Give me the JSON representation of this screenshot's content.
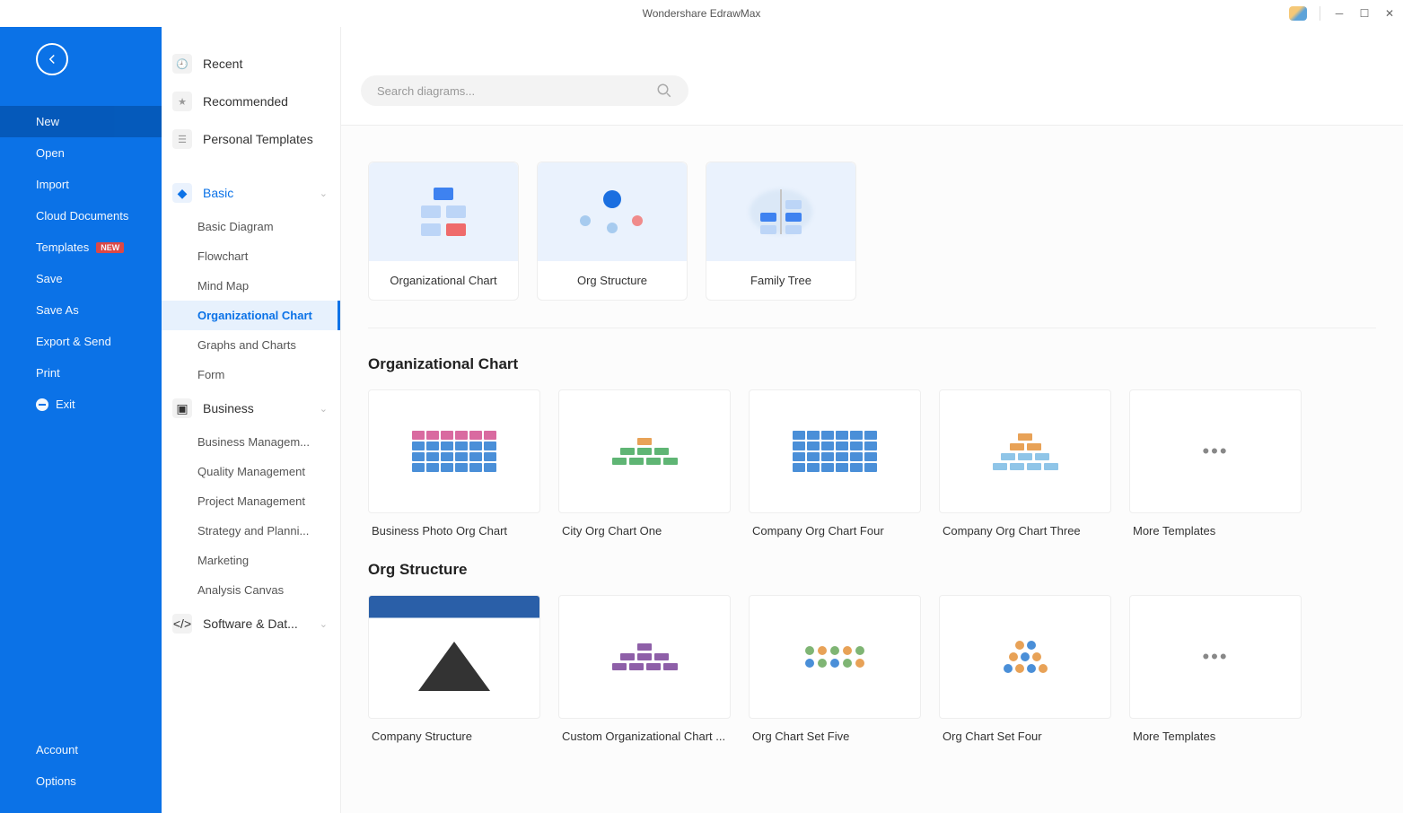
{
  "app": {
    "title": "Wondershare EdrawMax"
  },
  "search": {
    "placeholder": "Search diagrams..."
  },
  "sidebar": {
    "items": [
      {
        "label": "New",
        "active": true
      },
      {
        "label": "Open"
      },
      {
        "label": "Import"
      },
      {
        "label": "Cloud Documents"
      },
      {
        "label": "Templates",
        "badge": "NEW"
      },
      {
        "label": "Save"
      },
      {
        "label": "Save As"
      },
      {
        "label": "Export & Send"
      },
      {
        "label": "Print"
      },
      {
        "label": "Exit",
        "icon": "minus"
      }
    ],
    "bottom": [
      {
        "label": "Account"
      },
      {
        "label": "Options"
      }
    ]
  },
  "categories": {
    "top": [
      {
        "label": "Recent",
        "icon": "clock"
      },
      {
        "label": "Recommended",
        "icon": "star"
      },
      {
        "label": "Personal Templates",
        "icon": "layers"
      }
    ],
    "groups": [
      {
        "label": "Basic",
        "accent": true,
        "expanded": true,
        "subs": [
          "Basic Diagram",
          "Flowchart",
          "Mind Map",
          "Organizational Chart",
          "Graphs and Charts",
          "Form"
        ],
        "selected": "Organizational Chart"
      },
      {
        "label": "Business",
        "expanded": true,
        "subs": [
          "Business Managem...",
          "Quality Management",
          "Project Management",
          "Strategy and Planni...",
          "Marketing",
          "Analysis Canvas"
        ]
      },
      {
        "label": "Software & Dat...",
        "expanded": true,
        "subs": []
      }
    ]
  },
  "topCards": [
    {
      "label": "Organizational Chart"
    },
    {
      "label": "Org Structure"
    },
    {
      "label": "Family Tree"
    }
  ],
  "sections": [
    {
      "title": "Organizational Chart",
      "templates": [
        {
          "label": "Business Photo Org Chart"
        },
        {
          "label": "City Org Chart One"
        },
        {
          "label": "Company Org Chart Four"
        },
        {
          "label": "Company Org Chart Three"
        },
        {
          "label": "More Templates",
          "more": true
        }
      ]
    },
    {
      "title": "Org Structure",
      "templates": [
        {
          "label": "Company Structure"
        },
        {
          "label": "Custom Organizational Chart ..."
        },
        {
          "label": "Org Chart Set Five"
        },
        {
          "label": "Org Chart Set Four"
        },
        {
          "label": "More Templates",
          "more": true
        }
      ]
    }
  ]
}
